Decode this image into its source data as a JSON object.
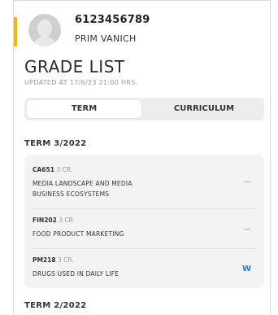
{
  "profile": {
    "student_id": "6123456789",
    "student_name": "PRIM VANICH"
  },
  "page": {
    "title": "GRADE LIST",
    "updated": "UPDATED AT 17/6/23 21:00 HRS."
  },
  "tabs": [
    {
      "label": "TERM",
      "active": true
    },
    {
      "label": "CURRICULUM",
      "active": false
    }
  ],
  "terms": [
    {
      "title": "TERM 3/2022",
      "courses": [
        {
          "code": "CA651",
          "credits": "3 CR.",
          "name_line1": "MEDIA LANDSCAPE AND MEDIA",
          "name_line2": "BUSINESS ECOSYSTEMS",
          "grade": "—"
        },
        {
          "code": "FIN202",
          "credits": "3 CR.",
          "name_line1": "FOOD PRODUCT MARKETING",
          "grade": "—"
        },
        {
          "code": "PM218",
          "credits": "3 CR.",
          "name_line1": "DRUGS USED IN DAILY LIFE",
          "grade": "W"
        }
      ]
    },
    {
      "title": "TERM 2/2022",
      "courses": []
    }
  ],
  "colors": {
    "accent": "#f5b800",
    "withdraw_grade": "#2f7fd3"
  },
  "icons": {
    "avatar": "user-avatar-icon"
  }
}
